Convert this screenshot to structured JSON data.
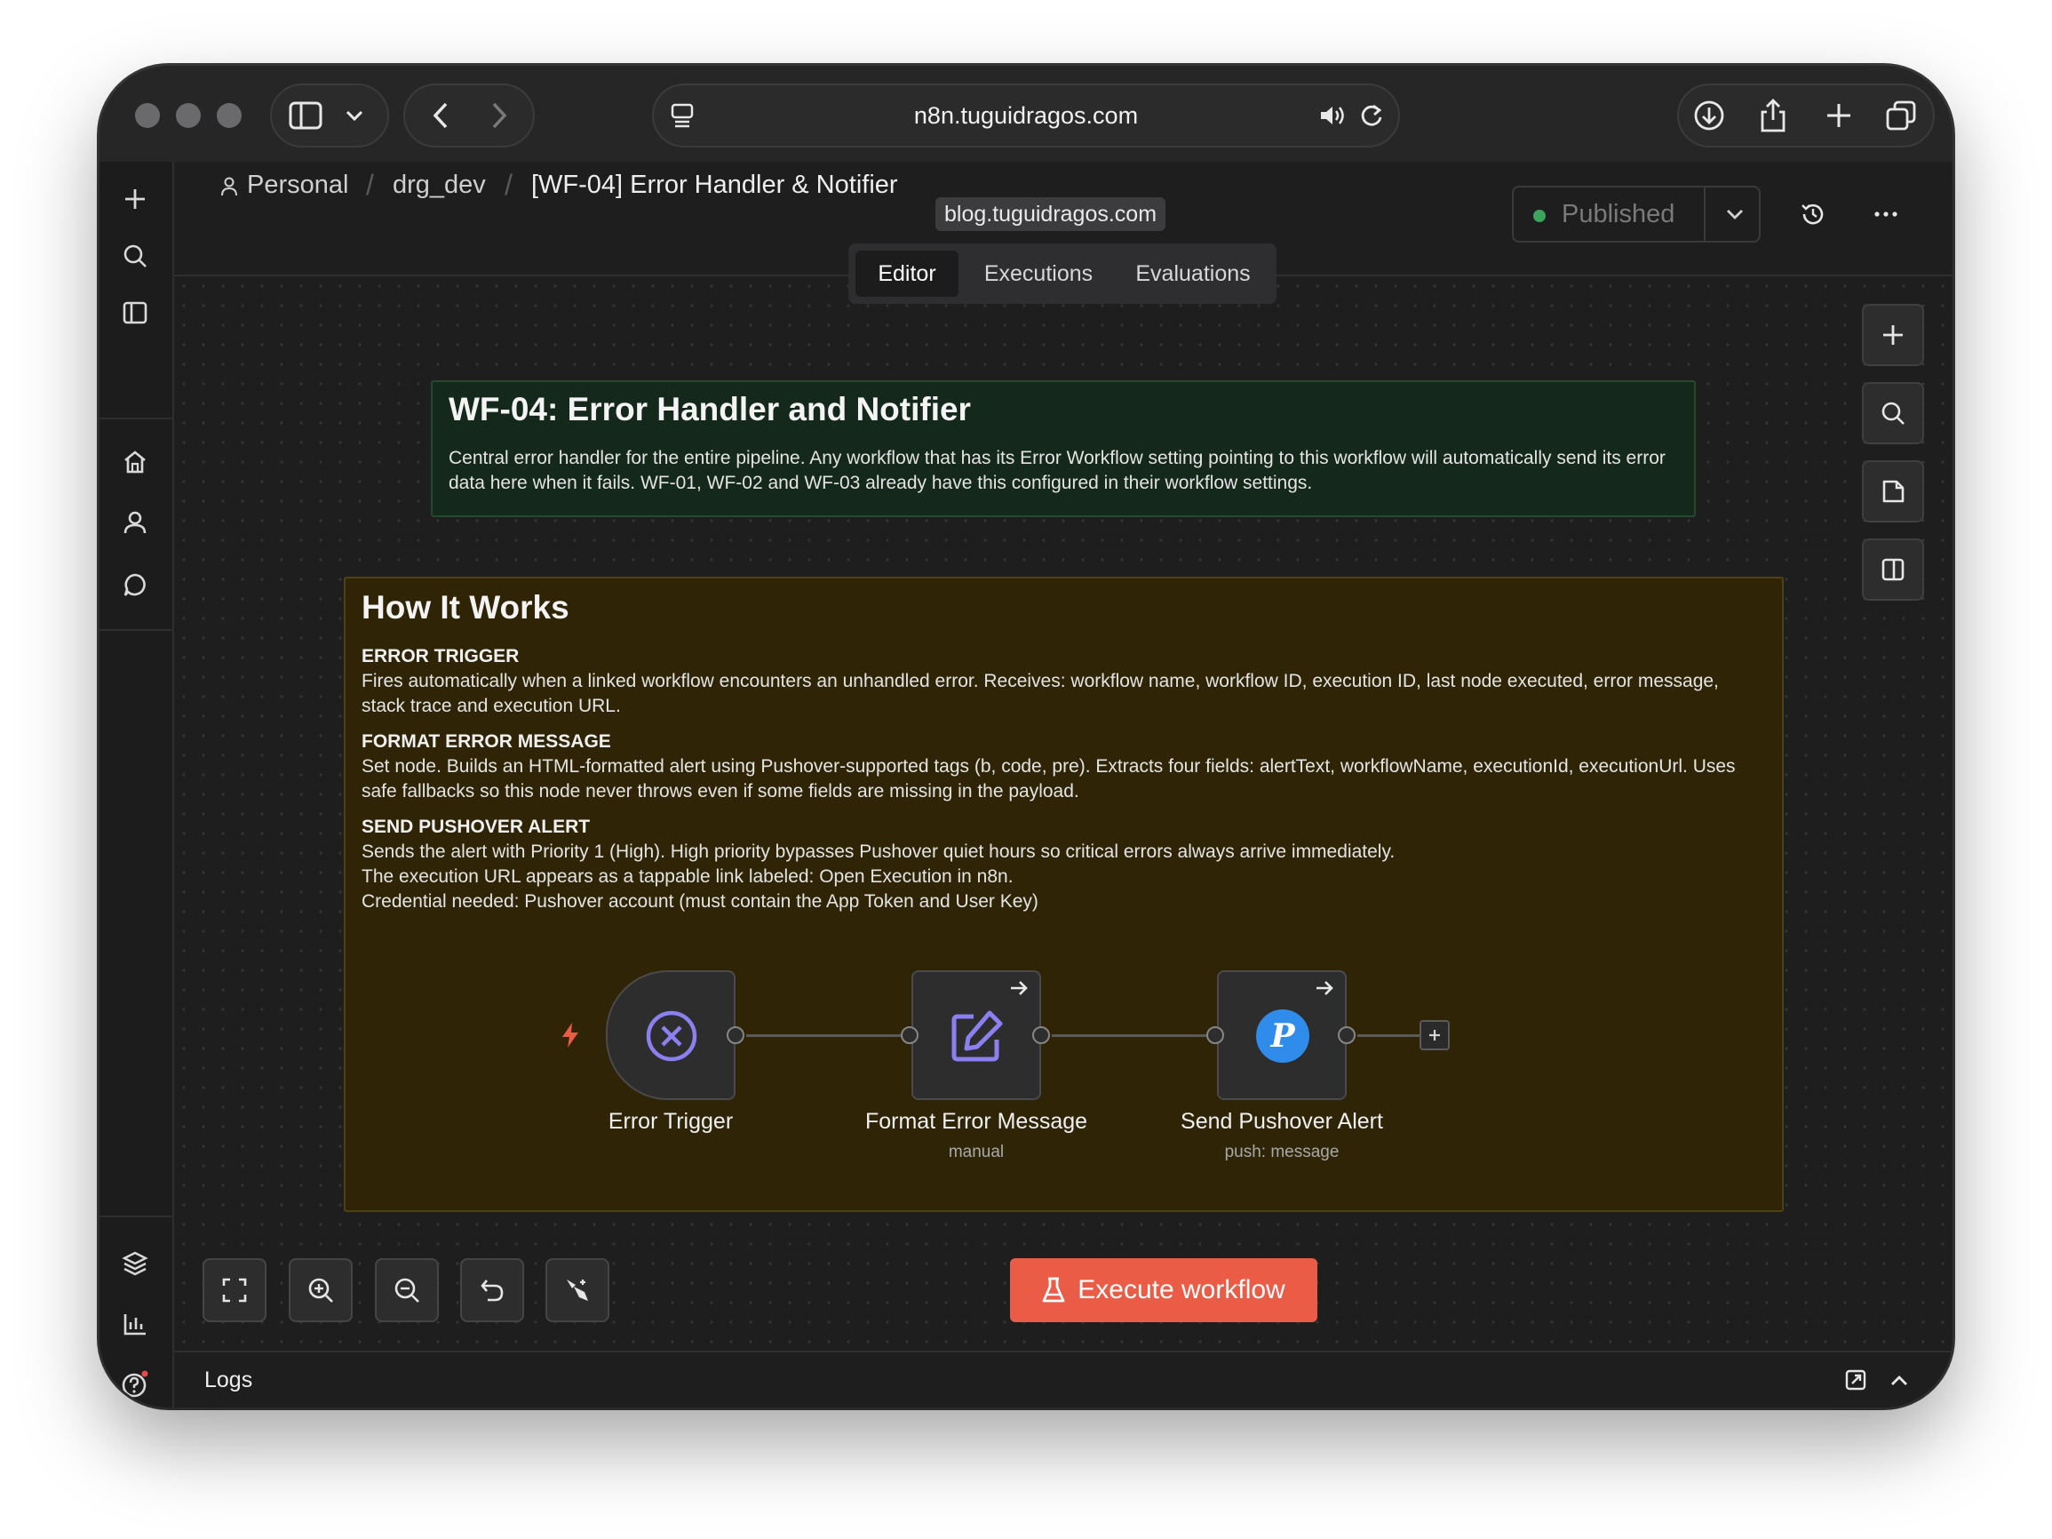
{
  "browser": {
    "url": "n8n.tuguidragos.com"
  },
  "breadcrumb": {
    "project": "Personal",
    "folder": "drg_dev",
    "workflow": "[WF-04] Error Handler & Notifier",
    "tag": "blog.tuguidragos.com"
  },
  "status": {
    "label": "Published",
    "dot_color": "#3ba55c"
  },
  "tabs": [
    {
      "label": "Editor",
      "active": true
    },
    {
      "label": "Executions",
      "active": false
    },
    {
      "label": "Evaluations",
      "active": false
    }
  ],
  "sticky_green": {
    "title": "WF-04: Error Handler and Notifier",
    "body": "Central error handler for the entire pipeline. Any workflow that has its Error Workflow setting pointing to this workflow will automatically send its error data here when it fails. WF-01, WF-02 and WF-03 already have this configured in their workflow settings."
  },
  "sticky_brown": {
    "title": "How It Works",
    "sections": [
      {
        "heading": "ERROR TRIGGER",
        "body": "Fires automatically when a linked workflow encounters an unhandled error. Receives: workflow name, workflow ID, execution ID, last node executed, error message, stack trace and execution URL."
      },
      {
        "heading": "FORMAT ERROR MESSAGE",
        "body": "Set node. Builds an HTML-formatted alert using Pushover-supported tags (b, code, pre). Extracts four fields: alertText, workflowName, executionId, executionUrl. Uses safe fallbacks so this node never throws even if some fields are missing in the payload."
      },
      {
        "heading": "SEND PUSHOVER ALERT",
        "lines": [
          "Sends the alert with Priority 1 (High). High priority bypasses Pushover quiet hours so critical errors always arrive immediately.",
          "The execution URL appears as a tappable link labeled: Open Execution in n8n.",
          "Credential needed: Pushover account (must contain the App Token and User Key)"
        ]
      }
    ]
  },
  "nodes": [
    {
      "label": "Error Trigger",
      "subtitle": "",
      "icon": "x-circle-icon"
    },
    {
      "label": "Format Error Message",
      "subtitle": "manual",
      "icon": "edit-icon"
    },
    {
      "label": "Send Pushover Alert",
      "subtitle": "push: message",
      "icon": "pushover-icon",
      "icon_glyph": "P"
    }
  ],
  "actions": {
    "execute_label": "Execute workflow",
    "execute_color": "#ea5c46"
  },
  "logs": {
    "label": "Logs"
  },
  "colors": {
    "accent_purple": "#8b80f0",
    "pushover_blue": "#2f8ceb",
    "trigger_bolt": "#ea5c46"
  }
}
